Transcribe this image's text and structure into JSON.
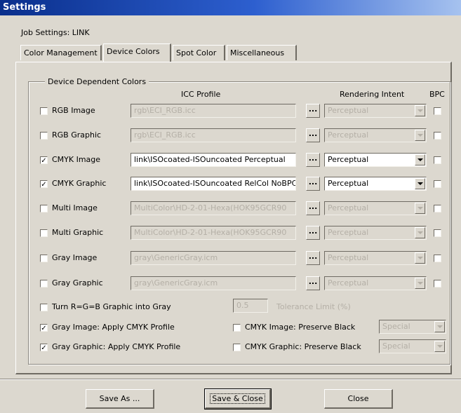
{
  "window": {
    "title": "Settings"
  },
  "job_settings": "Job Settings:  LINK",
  "tabs": [
    {
      "label": "Color Management"
    },
    {
      "label": "Device Colors",
      "active": true
    },
    {
      "label": "Spot Color"
    },
    {
      "label": "Miscellaneous"
    }
  ],
  "group": {
    "title": "Device Dependent Colors",
    "headers": {
      "icc_profile": "ICC Profile",
      "rendering_intent": "Rendering Intent",
      "bpc": "BPC"
    }
  },
  "rows": [
    {
      "label": "RGB Image",
      "checked": false,
      "profile": "rgb\\ECI_RGB.icc",
      "intent": "Perceptual",
      "enabled": false,
      "bpc": false
    },
    {
      "label": "RGB Graphic",
      "checked": false,
      "profile": "rgb\\ECI_RGB.icc",
      "intent": "Perceptual",
      "enabled": false,
      "bpc": false
    },
    {
      "label": "CMYK Image",
      "checked": true,
      "profile": "link\\ISOcoated-ISOuncoated Perceptual",
      "intent": "Perceptual",
      "enabled": true,
      "bpc": false
    },
    {
      "label": "CMYK Graphic",
      "checked": true,
      "profile": "link\\ISOcoated-ISOuncoated RelCol NoBPC",
      "intent": "Perceptual",
      "enabled": true,
      "bpc": false
    },
    {
      "label": "Multi Image",
      "checked": false,
      "profile": "MultiColor\\HD-2-01-Hexa(HOK95GCR90",
      "intent": "Perceptual",
      "enabled": false,
      "bpc": false
    },
    {
      "label": "Multi Graphic",
      "checked": false,
      "profile": "MultiColor\\HD-2-01-Hexa(HOK95GCR90",
      "intent": "Perceptual",
      "enabled": false,
      "bpc": false
    },
    {
      "label": "Gray Image",
      "checked": false,
      "profile": "gray\\GenericGray.icm",
      "intent": "Perceptual",
      "enabled": false,
      "bpc": false
    },
    {
      "label": "Gray Graphic",
      "checked": false,
      "profile": "gray\\GenericGray.icm",
      "intent": "Perceptual",
      "enabled": false,
      "bpc": false
    }
  ],
  "browse_label": "...",
  "options": {
    "rgb_to_gray": {
      "label": "Turn R=G=B Graphic into Gray",
      "checked": false
    },
    "tolerance": {
      "value": "0.5",
      "label": "Tolerance Limit (%)"
    },
    "gray_image_cmyk": {
      "label": "Gray Image: Apply CMYK Profile",
      "checked": true
    },
    "gray_graphic_cmyk": {
      "label": "Gray Graphic: Apply CMYK Profile",
      "checked": true
    },
    "cmyk_image_black": {
      "label": "CMYK Image: Preserve Black",
      "checked": false,
      "mode": "Special"
    },
    "cmyk_graphic_black": {
      "label": "CMYK Graphic: Preserve Black",
      "checked": false,
      "mode": "Special"
    }
  },
  "buttons": {
    "save_as": "Save As ...",
    "save_close": "Save & Close",
    "close": "Close"
  }
}
